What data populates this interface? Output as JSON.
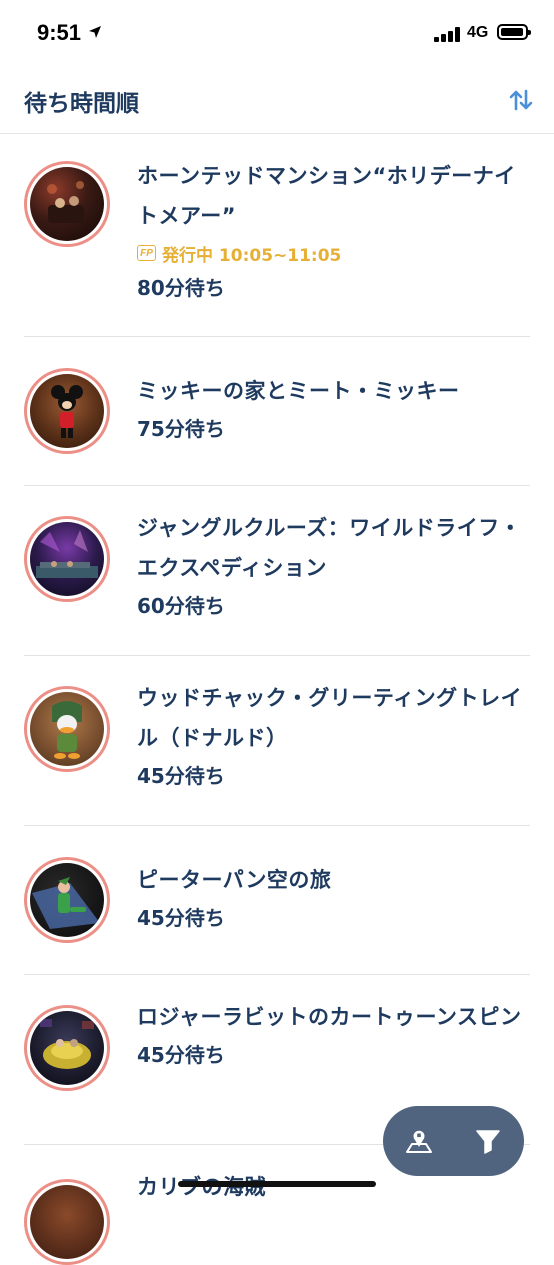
{
  "status_bar": {
    "time": "9:51",
    "network": "4G"
  },
  "header": {
    "title": "待ち時間順",
    "sort_icon": "sort-arrows-icon"
  },
  "attractions": [
    {
      "name": "ホーンテッドマンション“ホリデーナイトメアー”",
      "fastpass": {
        "badge": "FP",
        "text": "発行中 10:05~11:05"
      },
      "wait": "80分待ち"
    },
    {
      "name": "ミッキーの家とミート・ミッキー",
      "wait": "75分待ち"
    },
    {
      "name": "ジャングルクルーズ：ワイルドライフ・エクスペディション",
      "wait": "60分待ち"
    },
    {
      "name": "ウッドチャック・グリーティングトレイル（ドナルド）",
      "wait": "45分待ち"
    },
    {
      "name": "ピーターパン空の旅",
      "wait": "45分待ち"
    },
    {
      "name": "ロジャーラビットのカートゥーンスピン",
      "wait": "45分待ち"
    },
    {
      "name": "カリブの海賊",
      "wait": ""
    }
  ],
  "fab": {
    "map_icon": "map-pin-icon",
    "filter_icon": "filter-icon"
  },
  "colors": {
    "accent": "#1f3a5f",
    "fastpass": "#e6b037",
    "avatar_ring": "#ec8f86",
    "fab_bg": "#51647f",
    "sort_icon": "#4a90d9"
  }
}
